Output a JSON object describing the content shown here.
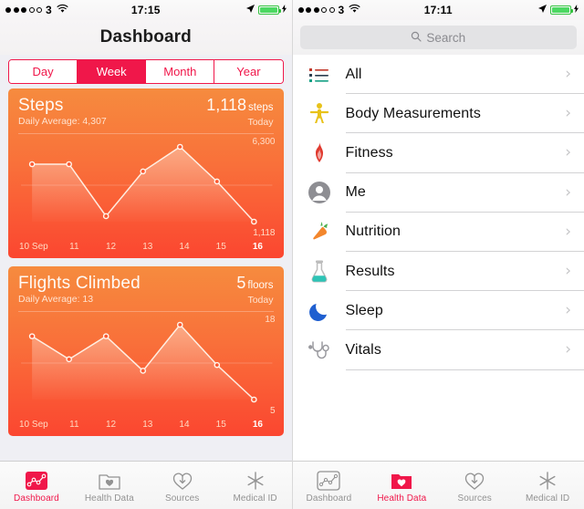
{
  "left": {
    "status": {
      "carrier": "3",
      "time": "17:15",
      "signal_filled": 3,
      "signal_empty": 2,
      "battery_icon": "battery-icon",
      "location_icon": "location-arrow-icon",
      "wifi_icon": "wifi-icon",
      "bolt": "⚡"
    },
    "nav": {
      "title": "Dashboard"
    },
    "segmented": {
      "options": [
        "Day",
        "Week",
        "Month",
        "Year"
      ],
      "selected": "Week"
    },
    "cards": [
      {
        "title": "Steps",
        "subtitle": "Daily Average: 4,307",
        "value": "1,118",
        "unit": "steps",
        "today": "Today",
        "chart_ref": 0
      },
      {
        "title": "Flights Climbed",
        "subtitle": "Daily Average: 13",
        "value": "5",
        "unit": "floors",
        "today": "Today",
        "chart_ref": 1
      }
    ],
    "tabs": [
      {
        "label": "Dashboard",
        "icon": "dashboard-chart-icon",
        "active": true
      },
      {
        "label": "Health Data",
        "icon": "health-data-folder-icon",
        "active": false
      },
      {
        "label": "Sources",
        "icon": "sources-download-heart-icon",
        "active": false
      },
      {
        "label": "Medical ID",
        "icon": "medical-id-asterisk-icon",
        "active": false
      }
    ]
  },
  "right": {
    "status": {
      "carrier": "3",
      "time": "17:11",
      "signal_filled": 3,
      "signal_empty": 2,
      "battery_icon": "battery-icon",
      "location_icon": "location-arrow-icon",
      "wifi_icon": "wifi-icon",
      "bolt": "⚡"
    },
    "search": {
      "placeholder": "Search",
      "value": "",
      "icon": "search-icon"
    },
    "list": [
      {
        "label": "All",
        "icon": "all-list-icon"
      },
      {
        "label": "Body Measurements",
        "icon": "body-measurements-icon"
      },
      {
        "label": "Fitness",
        "icon": "fitness-flame-icon"
      },
      {
        "label": "Me",
        "icon": "me-person-icon"
      },
      {
        "label": "Nutrition",
        "icon": "nutrition-carrot-icon"
      },
      {
        "label": "Results",
        "icon": "results-flask-icon"
      },
      {
        "label": "Sleep",
        "icon": "sleep-moon-icon"
      },
      {
        "label": "Vitals",
        "icon": "vitals-stethoscope-icon"
      }
    ],
    "tabs": [
      {
        "label": "Dashboard",
        "icon": "dashboard-chart-icon",
        "active": false
      },
      {
        "label": "Health Data",
        "icon": "health-data-folder-icon",
        "active": true
      },
      {
        "label": "Sources",
        "icon": "sources-download-heart-icon",
        "active": false
      },
      {
        "label": "Medical ID",
        "icon": "medical-id-asterisk-icon",
        "active": false
      }
    ]
  },
  "colors": {
    "accent": "#f0174a",
    "card_top": "#f68b3e",
    "card_bottom": "#fb4630",
    "tab_inactive": "#929292",
    "battery_green": "#4cd862"
  },
  "chart_data": [
    {
      "type": "line",
      "title": "Steps",
      "subtitle": "Daily Average: 4,307",
      "categories": [
        "10 Sep",
        "11",
        "12",
        "13",
        "14",
        "15",
        "16"
      ],
      "values": [
        5100,
        5100,
        1500,
        4600,
        6300,
        3900,
        1118
      ],
      "ylim": [
        0,
        6300
      ],
      "ymax_label": "6,300",
      "ymin_label": "1,118",
      "highlight_category": "16",
      "xlabel": "",
      "ylabel": "steps",
      "grid": true,
      "legend": "none"
    },
    {
      "type": "line",
      "title": "Flights Climbed",
      "subtitle": "Daily Average: 13",
      "categories": [
        "10 Sep",
        "11",
        "12",
        "13",
        "14",
        "15",
        "16"
      ],
      "values": [
        16,
        12,
        16,
        10,
        18,
        11,
        5
      ],
      "ylim": [
        0,
        18
      ],
      "ymax_label": "18",
      "ymin_label": "5",
      "highlight_category": "16",
      "xlabel": "",
      "ylabel": "floors",
      "grid": true,
      "legend": "none"
    }
  ]
}
